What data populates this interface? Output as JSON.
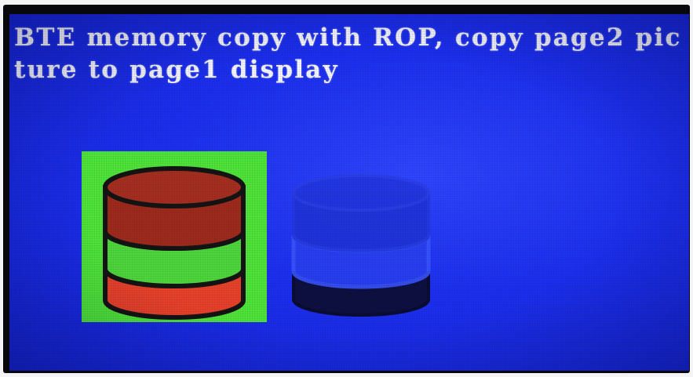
{
  "screen": {
    "caption": "BTE memory copy with ROP, copy page2 picture to page1 display",
    "colors": {
      "background": "#1c2ff0",
      "text": "#f6f7ff",
      "icon_box": "#4fe43a",
      "db_top": "#9e2a1d",
      "db_middle": "#4ed73c",
      "db_bottom": "#e8412a",
      "outline": "#141414"
    }
  },
  "icons": {
    "source": "database-icon",
    "rop_result": "database-icon"
  }
}
